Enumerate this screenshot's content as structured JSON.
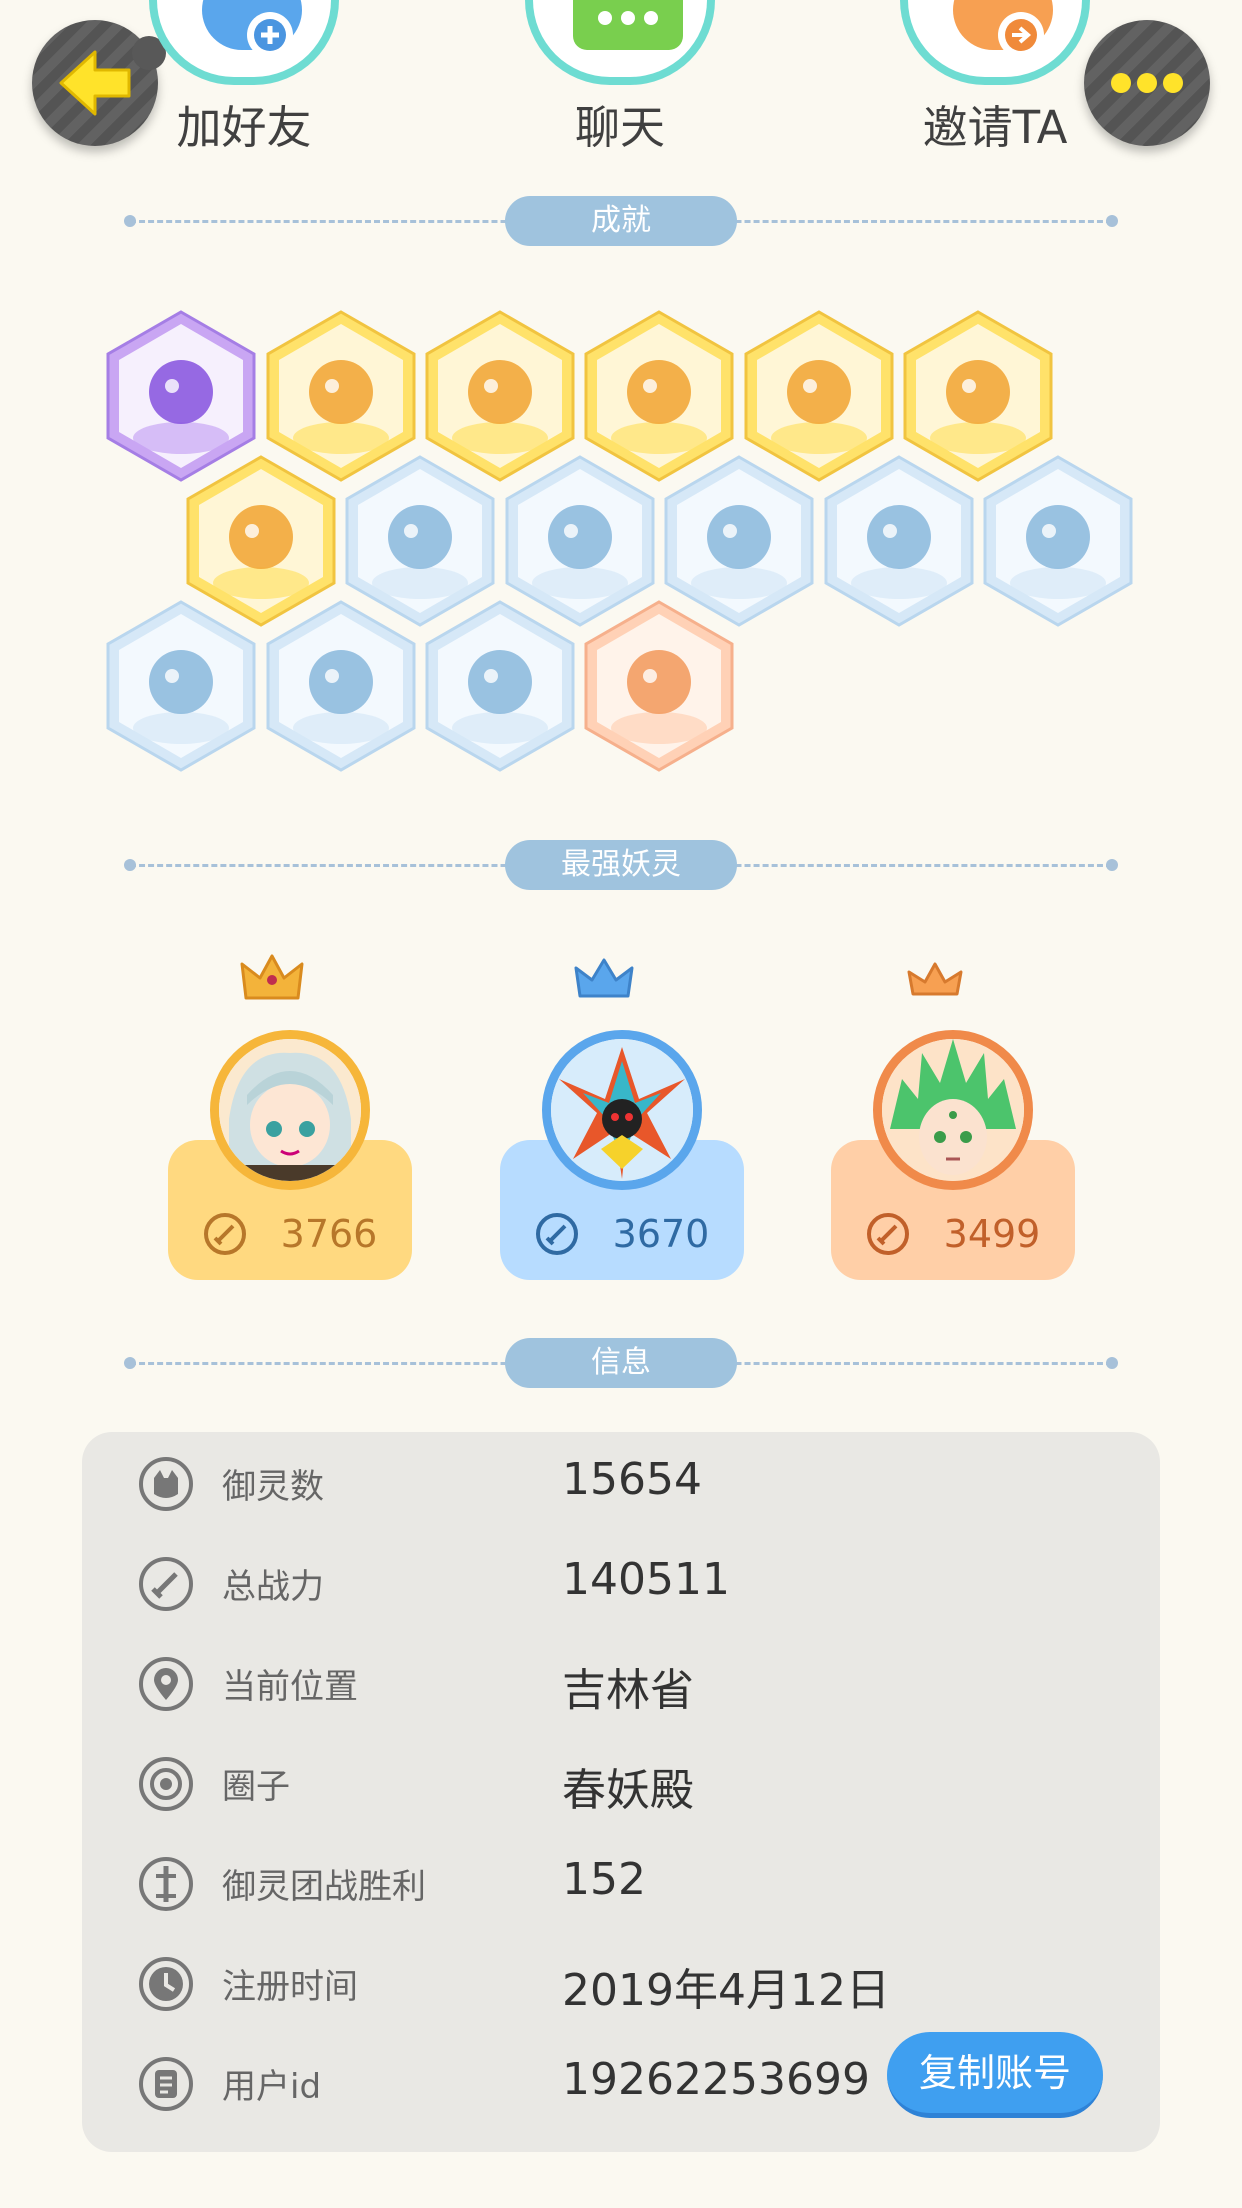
{
  "top_actions": [
    {
      "label": "加好友"
    },
    {
      "label": "聊天"
    },
    {
      "label": "邀请TA"
    }
  ],
  "sections": {
    "achievements": "成就",
    "strongest": "最强妖灵",
    "info": "信息"
  },
  "achievement_badges": [
    {
      "icon": "purple-cat-moon-icon",
      "frame": "purple"
    },
    {
      "icon": "sun-staff-icon",
      "frame": "gold"
    },
    {
      "icon": "golden-cloud-icon",
      "frame": "gold"
    },
    {
      "icon": "amber-egg-icon",
      "frame": "gold"
    },
    {
      "icon": "yin-yang-comet-icon",
      "frame": "gold"
    },
    {
      "icon": "yin-yang-block-icon",
      "frame": "gold"
    },
    {
      "icon": "fox-book-icon",
      "frame": "gold"
    },
    {
      "icon": "sneaker-icon",
      "frame": "blue"
    },
    {
      "icon": "moon-orb-icon",
      "frame": "blue"
    },
    {
      "icon": "spirit-figure-icon",
      "frame": "blue"
    },
    {
      "icon": "cat-balloon-icon",
      "frame": "blue"
    },
    {
      "icon": "koi-fish-icon",
      "frame": "blue"
    },
    {
      "icon": "shield-icon",
      "frame": "blue"
    },
    {
      "icon": "horned-monster-icon",
      "frame": "blue"
    },
    {
      "icon": "ghost-cat-icon",
      "frame": "blue"
    },
    {
      "icon": "cat-stroller-icon",
      "frame": "orange"
    }
  ],
  "top_spirits": [
    {
      "power": "3766",
      "theme": "gold",
      "card_color": "#ffd980",
      "ring_color": "#f6b63a",
      "text_color": "#b7772a",
      "crown": "gold-crown-icon"
    },
    {
      "power": "3670",
      "theme": "blue",
      "card_color": "#b7dcff",
      "ring_color": "#5aa6ec",
      "text_color": "#2f6aa3",
      "crown": "blue-crown-icon"
    },
    {
      "power": "3499",
      "theme": "orange",
      "card_color": "#ffcfa7",
      "ring_color": "#f08a4a",
      "text_color": "#c1602a",
      "crown": "orange-crown-icon"
    }
  ],
  "info_rows": [
    {
      "icon": "spirit-count-icon",
      "label": "御灵数",
      "value": "15654"
    },
    {
      "icon": "sword-power-icon",
      "label": "总战力",
      "value": "140511"
    },
    {
      "icon": "location-pin-icon",
      "label": "当前位置",
      "value": "吉林省"
    },
    {
      "icon": "circle-group-icon",
      "label": "圈子",
      "value": "春妖殿"
    },
    {
      "icon": "team-battle-icon",
      "label": "御灵团战胜利",
      "value": "152"
    },
    {
      "icon": "clock-icon",
      "label": "注册时间",
      "value": "2019年4月12日"
    },
    {
      "icon": "id-card-icon",
      "label": "用户id",
      "value": "19262253699"
    }
  ],
  "copy_button": "复制账号"
}
